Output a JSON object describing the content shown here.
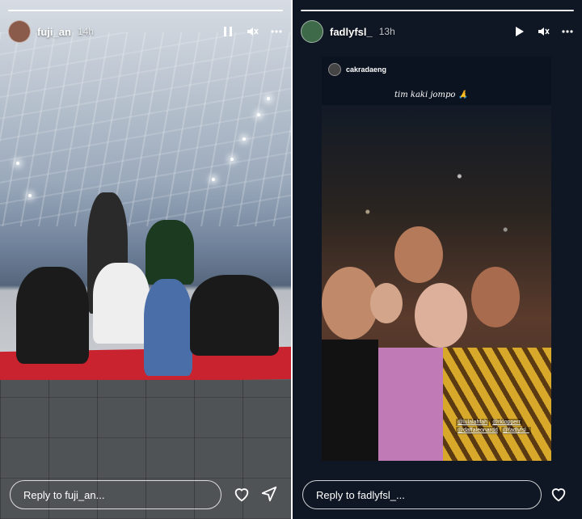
{
  "left_story": {
    "username": "fuji_an",
    "time": "14h",
    "reply_placeholder": "Reply to fuji_an...",
    "progress_segments": 1
  },
  "right_story": {
    "username": "fadlyfsl_",
    "time": "13h",
    "reply_placeholder": "Reply to fadlyfsl_...",
    "progress_segments": 1,
    "repost": {
      "author": "cakradaeng",
      "caption": "tim kaki jompo 🙏",
      "mentions": [
        "@lulalahfah",
        "@rklopperr",
        "@daffaleonardd",
        "@fadlyfsl_"
      ]
    }
  },
  "icons": {
    "pause": "pause-icon",
    "play": "play-icon",
    "mute": "mute-icon",
    "more": "more-icon",
    "heart": "heart-icon",
    "send": "send-icon"
  },
  "colors": {
    "mat_red": "#c8232e",
    "right_bg": "#0f1724"
  }
}
